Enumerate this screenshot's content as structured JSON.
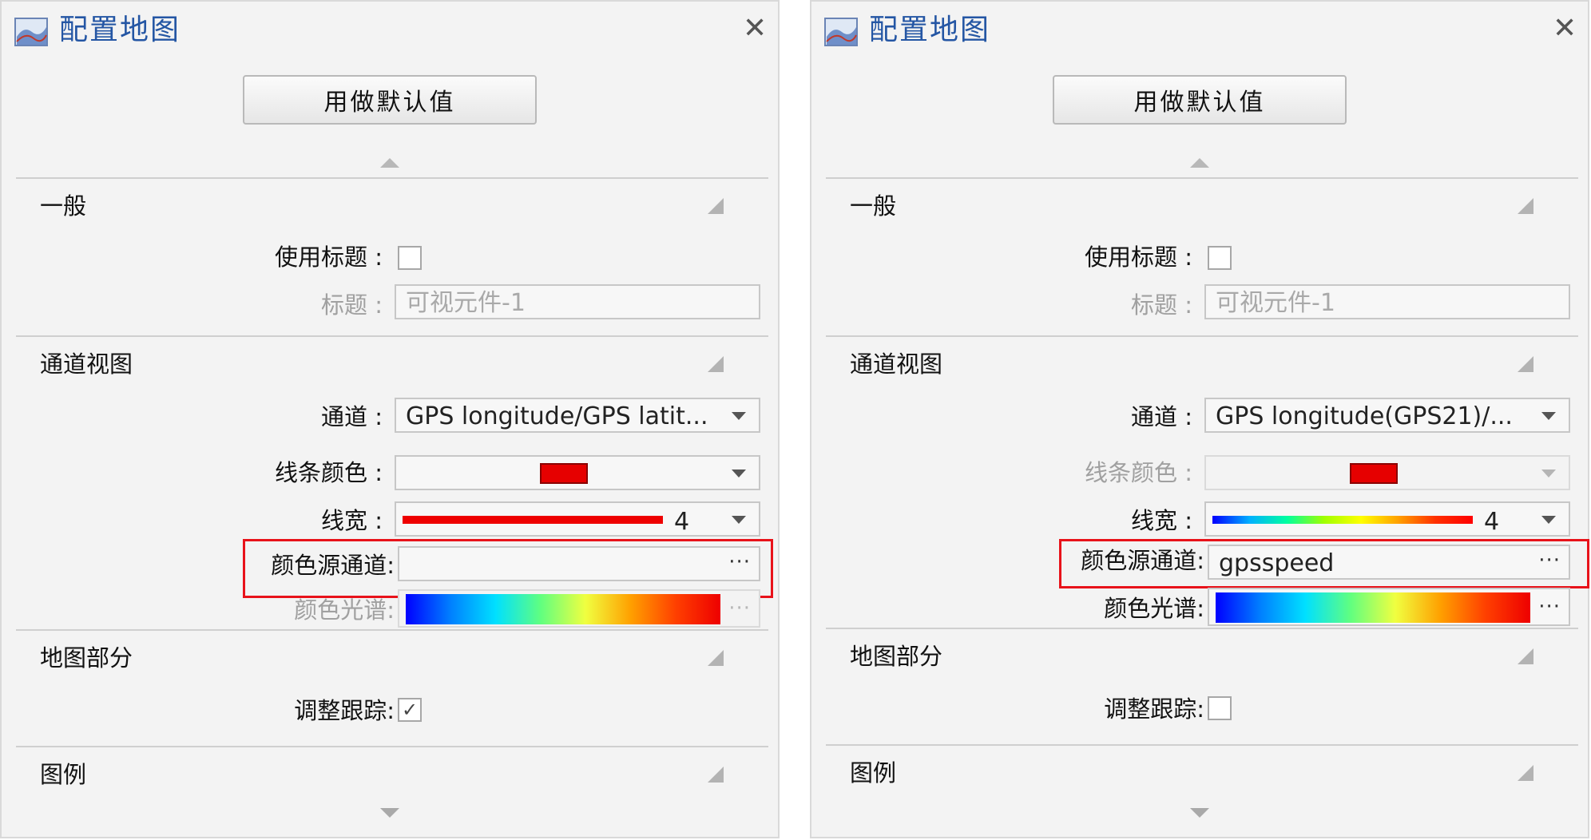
{
  "panels": [
    {
      "title": "配置地图",
      "close_glyph": "✕",
      "default_button": "用做默认值",
      "sections": {
        "general": "一般",
        "channel_view": "通道视图",
        "map_part": "地图部分",
        "legend": "图例"
      },
      "labels": {
        "use_title": "使用标题 :",
        "title": "标题 :",
        "channel": "通道 :",
        "line_color": "线条颜色 :",
        "line_width": "线宽 :",
        "color_source": "颜色源通道:",
        "spectrum": "颜色光谱:",
        "adjust_tracking": "调整跟踪:"
      },
      "values": {
        "use_title_checked": "",
        "title_placeholder": "可视元件-1",
        "channel": "GPS longitude/GPS latit...",
        "line_color": "#e60000",
        "line_width": "4",
        "color_source": "",
        "more": "···",
        "adjust_tracking_mark": "✓"
      },
      "states": {
        "line_color_enabled": true,
        "spectrum_enabled": false,
        "line_width_style": "red"
      }
    },
    {
      "title": "配置地图",
      "close_glyph": "✕",
      "default_button": "用做默认值",
      "sections": {
        "general": "一般",
        "channel_view": "通道视图",
        "map_part": "地图部分",
        "legend": "图例"
      },
      "labels": {
        "use_title": "使用标题 :",
        "title": "标题 :",
        "channel": "通道 :",
        "line_color": "线条颜色 :",
        "line_width": "线宽 :",
        "color_source": "颜色源通道:",
        "spectrum": "颜色光谱:",
        "adjust_tracking": "调整跟踪:"
      },
      "values": {
        "use_title_checked": "",
        "title_placeholder": "可视元件-1",
        "channel": "GPS longitude(GPS21)/...",
        "line_color": "#e60000",
        "line_width": "4",
        "color_source": "gpsspeed",
        "more": "···",
        "adjust_tracking_mark": ""
      },
      "states": {
        "line_color_enabled": false,
        "spectrum_enabled": true,
        "line_width_style": "spectrum"
      }
    }
  ],
  "colors": {
    "highlight": "#e8121a",
    "title_blue": "#2456a4"
  }
}
